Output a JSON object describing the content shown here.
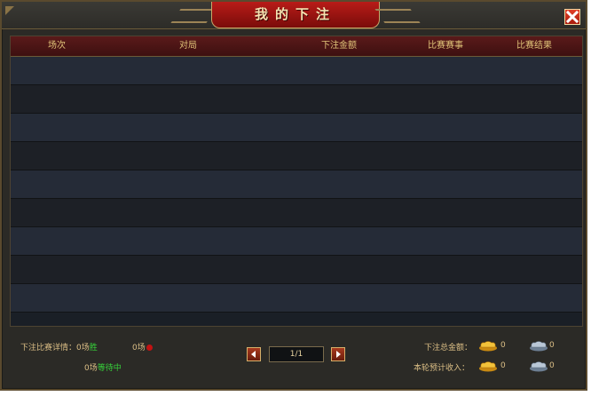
{
  "window": {
    "title": "我的下注",
    "close_icon": "close-icon"
  },
  "table": {
    "headers": [
      "场次",
      "对局",
      "下注金额",
      "比赛赛事",
      "比赛结果"
    ],
    "rows": 9
  },
  "summary": {
    "detail_label": "下注比赛详情：",
    "win_count": "0场",
    "win_label": "胜",
    "lose_count": "0场",
    "pending_count": "0场",
    "pending_label": "等待中"
  },
  "pager": {
    "prev_icon": "triangle-left-icon",
    "next_icon": "triangle-right-icon",
    "page": "1/1"
  },
  "totals": {
    "total_bet_label": "下注总金额：",
    "total_bet_gold": "0",
    "total_bet_silver": "0",
    "expected_income_label": "本轮预计收入：",
    "expected_income_gold": "0",
    "expected_income_silver": "0",
    "gold_icon": "gold-ingot-icon",
    "silver_icon": "silver-ingot-icon"
  },
  "colors": {
    "title_plate": "#a01512",
    "header_text": "#e0c378",
    "win_green": "#36d33a",
    "lose_red": "#c31212"
  }
}
